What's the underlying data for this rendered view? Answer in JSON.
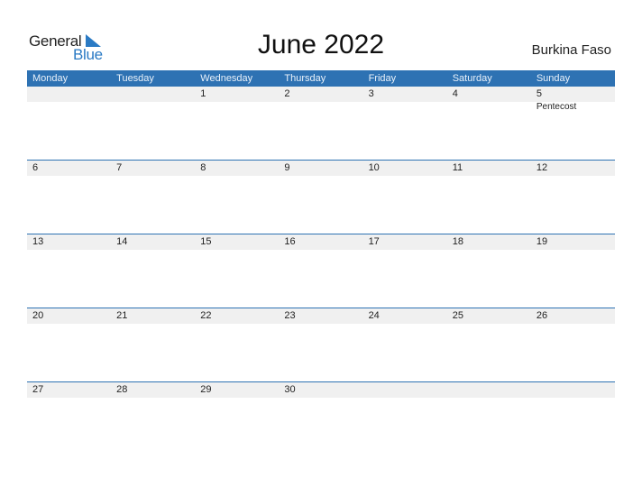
{
  "logo": {
    "general": "General",
    "blue": "Blue",
    "icon": "triangle-icon",
    "accent": "#2a7ac4"
  },
  "title": "June 2022",
  "country": "Burkina Faso",
  "colors": {
    "header_bg": "#2e72b3",
    "date_row_bg": "#f0f0f0"
  },
  "weekdays": [
    "Monday",
    "Tuesday",
    "Wednesday",
    "Thursday",
    "Friday",
    "Saturday",
    "Sunday"
  ],
  "weeks": [
    {
      "days": [
        "",
        "",
        "1",
        "2",
        "3",
        "4",
        "5"
      ],
      "events": [
        "",
        "",
        "",
        "",
        "",
        "",
        "Pentecost"
      ]
    },
    {
      "days": [
        "6",
        "7",
        "8",
        "9",
        "10",
        "11",
        "12"
      ],
      "events": [
        "",
        "",
        "",
        "",
        "",
        "",
        ""
      ]
    },
    {
      "days": [
        "13",
        "14",
        "15",
        "16",
        "17",
        "18",
        "19"
      ],
      "events": [
        "",
        "",
        "",
        "",
        "",
        "",
        ""
      ]
    },
    {
      "days": [
        "20",
        "21",
        "22",
        "23",
        "24",
        "25",
        "26"
      ],
      "events": [
        "",
        "",
        "",
        "",
        "",
        "",
        ""
      ]
    },
    {
      "days": [
        "27",
        "28",
        "29",
        "30",
        "",
        "",
        ""
      ],
      "events": [
        "",
        "",
        "",
        "",
        "",
        "",
        ""
      ]
    }
  ]
}
